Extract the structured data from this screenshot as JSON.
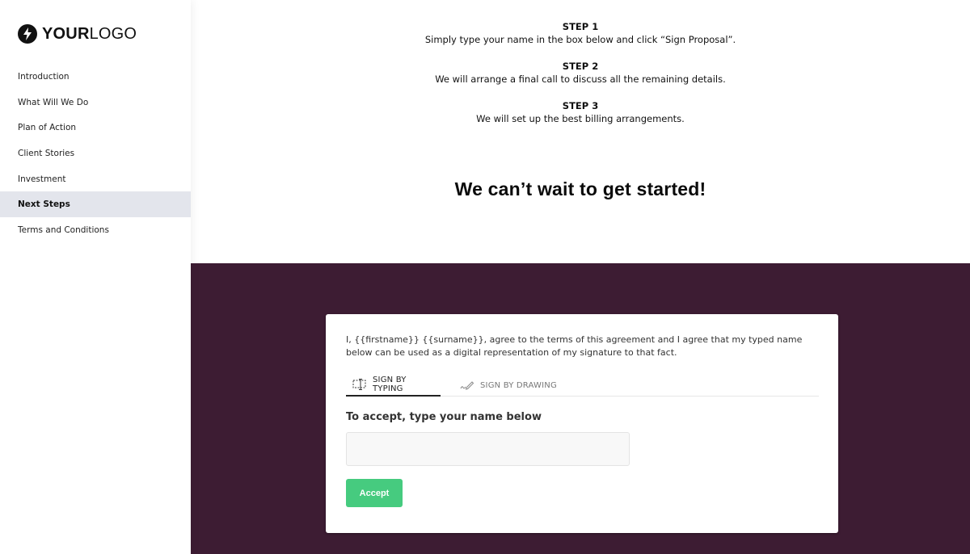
{
  "brand": {
    "logo_bold": "YOUR",
    "logo_light": "LOGO",
    "logo_icon": "lightning-bolt-icon"
  },
  "sidebar": {
    "items": [
      {
        "label": "Introduction",
        "active": false
      },
      {
        "label": "What Will We Do",
        "active": false
      },
      {
        "label": "Plan of Action",
        "active": false
      },
      {
        "label": "Client Stories",
        "active": false
      },
      {
        "label": "Investment",
        "active": false
      },
      {
        "label": "Next Steps",
        "active": true
      },
      {
        "label": "Terms and Conditions",
        "active": false
      }
    ]
  },
  "steps": [
    {
      "title": "STEP 1",
      "text": "Simply type your name in the box below and click “Sign Proposal”."
    },
    {
      "title": "STEP 2",
      "text": "We will arrange a final call to discuss all the remaining details."
    },
    {
      "title": "STEP 3",
      "text": "We will set up the best billing arrangements."
    }
  ],
  "cta": "We can’t wait to get started!",
  "colors": {
    "band": "#3d1c33",
    "accept": "#46cb7f",
    "active_nav": "#e3e5ec"
  },
  "signature": {
    "agreement_text": "I, {{firstname}} {{surname}}, agree to the terms of this agreement and I agree that my typed name below can be used as a digital representation of my signature to that fact.",
    "tabs": [
      {
        "label": "SIGN BY TYPING",
        "icon": "text-cursor-icon",
        "active": true
      },
      {
        "label": "SIGN BY DRAWING",
        "icon": "pen-signature-icon",
        "active": false
      }
    ],
    "input_label": "To accept, type your name below",
    "input_value": "",
    "input_placeholder": "",
    "accept_label": "Accept"
  }
}
